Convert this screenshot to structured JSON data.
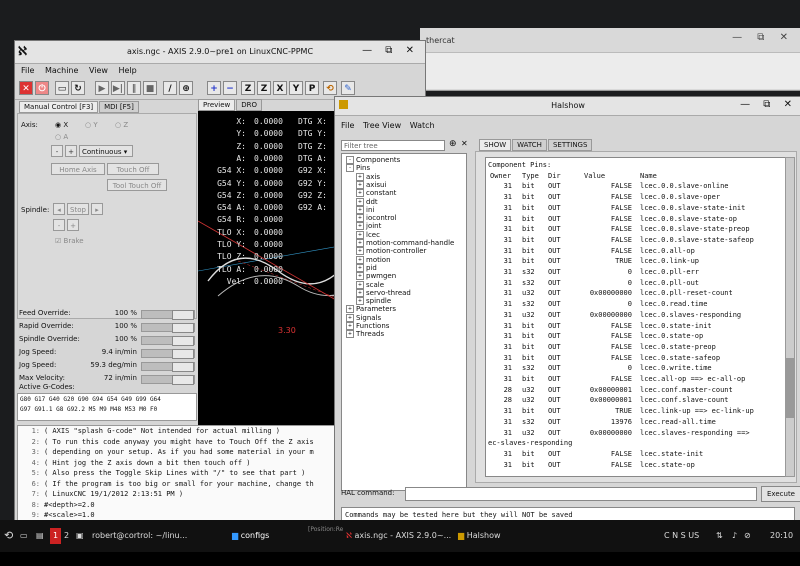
{
  "bg_window": {
    "tab_text": "thercat"
  },
  "axis": {
    "title": "axis.ngc - AXIS 2.9.0~pre1 on LinuxCNC-PPMC",
    "menu": [
      "File",
      "Machine",
      "View",
      "Help"
    ],
    "tabs": [
      "Manual Control [F3]",
      "MDI [F5]"
    ],
    "view_tabs": [
      "Preview",
      "DRO"
    ],
    "axis_label": "Axis:",
    "axes": [
      "X",
      "Y",
      "Z",
      "A"
    ],
    "jog_minus": "-",
    "jog_plus": "+",
    "jog_mode": "Continuous",
    "home_axis": "Home Axis",
    "touch_off": "Touch Off",
    "tool_touch_off": "Tool Touch Off",
    "spindle_label": "Spindle:",
    "stop": "Stop",
    "brake": "Brake",
    "overrides": [
      {
        "label": "Feed Override:",
        "value": "100 %"
      },
      {
        "label": "Rapid Override:",
        "value": "100 %"
      },
      {
        "label": "Spindle Override:",
        "value": "100 %"
      },
      {
        "label": "Jog Speed:",
        "value": "9.4 in/min"
      },
      {
        "label": "Jog Speed:",
        "value": "59.3 deg/min"
      },
      {
        "label": "Max Velocity:",
        "value": "72 in/min"
      }
    ],
    "active_gcodes_label": "Active G-Codes:",
    "active_gcodes": [
      "G80 G17 G40 G20 G90 G94 G54 G49 G99 G64",
      "G97 G91.1 G8 G92.2 M5 M9 M48 M53 M0 F0"
    ],
    "dro": [
      {
        "l": "X:",
        "v": "0.0000",
        "d": "DTG X:"
      },
      {
        "l": "Y:",
        "v": "0.0000",
        "d": "DTG Y:"
      },
      {
        "l": "Z:",
        "v": "0.0000",
        "d": "DTG Z:"
      },
      {
        "l": "A:",
        "v": "0.0000",
        "d": "DTG A:"
      },
      {
        "l": "G54 X:",
        "v": "0.0000",
        "d": "G92 X:"
      },
      {
        "l": "G54 Y:",
        "v": "0.0000",
        "d": "G92 Y:"
      },
      {
        "l": "G54 Z:",
        "v": "0.0000",
        "d": "G92 Z:"
      },
      {
        "l": "G54 A:",
        "v": "0.0000",
        "d": "G92 A:"
      },
      {
        "l": "G54 R:",
        "v": "0.0000",
        "d": ""
      },
      {
        "l": "TLO X:",
        "v": "0.0000",
        "d": ""
      },
      {
        "l": "TLO Y:",
        "v": "0.0000",
        "d": ""
      },
      {
        "l": "TLO Z:",
        "v": "0.0000",
        "d": ""
      },
      {
        "l": "TLO A:",
        "v": "0.0000",
        "d": ""
      },
      {
        "l": "Vel:",
        "v": "0.0000",
        "d": ""
      }
    ],
    "preview_text": "3.30",
    "code_lines": [
      {
        "n": "1:",
        "t": "( AXIS \"splash G-code\" Not intended for actual milling )"
      },
      {
        "n": "2:",
        "t": "( To run this code anyway you might have to Touch Off the Z axis"
      },
      {
        "n": "3:",
        "t": "( depending on your setup. As if you had some material in your m"
      },
      {
        "n": "4:",
        "t": "( Hint jog the Z axis down a bit then touch off )"
      },
      {
        "n": "5:",
        "t": "( Also press the Toggle Skip Lines with \"/\" to see that part )"
      },
      {
        "n": "6:",
        "t": "( If the program is too big or small for your machine, change th"
      },
      {
        "n": "7:",
        "t": "( LinuxCNC 19/1/2012 2:13:51 PM )"
      },
      {
        "n": "8:",
        "t": "#<depth>=2.0"
      },
      {
        "n": "9:",
        "t": "#<scale>=1.0"
      }
    ]
  },
  "halshow": {
    "title": "Halshow",
    "menu": [
      "File",
      "Tree View",
      "Watch"
    ],
    "filter_placeholder": "Filter tree",
    "tabs": [
      "SHOW",
      "WATCH",
      "SETTINGS"
    ],
    "tree": [
      {
        "label": "Components",
        "d": 0,
        "pm": "-"
      },
      {
        "label": "Pins",
        "d": 0,
        "pm": "-"
      },
      {
        "label": "axis",
        "d": 1,
        "pm": "+"
      },
      {
        "label": "axisui",
        "d": 1,
        "pm": "+"
      },
      {
        "label": "constant",
        "d": 1,
        "pm": "+"
      },
      {
        "label": "ddt",
        "d": 1,
        "pm": "+"
      },
      {
        "label": "ini",
        "d": 1,
        "pm": "+"
      },
      {
        "label": "iocontrol",
        "d": 1,
        "pm": "+"
      },
      {
        "label": "joint",
        "d": 1,
        "pm": "+"
      },
      {
        "label": "lcec",
        "d": 1,
        "pm": "+"
      },
      {
        "label": "motion-command-handle",
        "d": 1,
        "pm": "+"
      },
      {
        "label": "motion-controller",
        "d": 1,
        "pm": "+"
      },
      {
        "label": "motion",
        "d": 1,
        "pm": "+"
      },
      {
        "label": "pid",
        "d": 1,
        "pm": "+"
      },
      {
        "label": "pwmgen",
        "d": 1,
        "pm": "+"
      },
      {
        "label": "scale",
        "d": 1,
        "pm": "+"
      },
      {
        "label": "servo-thread",
        "d": 1,
        "pm": "+"
      },
      {
        "label": "spindle",
        "d": 1,
        "pm": "+"
      },
      {
        "label": "Parameters",
        "d": 0,
        "pm": "+"
      },
      {
        "label": "Signals",
        "d": 0,
        "pm": "+"
      },
      {
        "label": "Functions",
        "d": 0,
        "pm": "+"
      },
      {
        "label": "Threads",
        "d": 0,
        "pm": "+"
      }
    ],
    "pins_heading": "Component Pins:",
    "pins_header": {
      "o": "Owner",
      "t": "Type",
      "d": "Dir",
      "v": "Value",
      "n": "Name"
    },
    "pins": [
      {
        "o": "31",
        "t": "bit",
        "d": "OUT",
        "v": "FALSE",
        "n": "lcec.0.0.slave-online"
      },
      {
        "o": "31",
        "t": "bit",
        "d": "OUT",
        "v": "FALSE",
        "n": "lcec.0.0.slave-oper"
      },
      {
        "o": "31",
        "t": "bit",
        "d": "OUT",
        "v": "FALSE",
        "n": "lcec.0.0.slave-state-init"
      },
      {
        "o": "31",
        "t": "bit",
        "d": "OUT",
        "v": "FALSE",
        "n": "lcec.0.0.slave-state-op"
      },
      {
        "o": "31",
        "t": "bit",
        "d": "OUT",
        "v": "FALSE",
        "n": "lcec.0.0.slave-state-preop"
      },
      {
        "o": "31",
        "t": "bit",
        "d": "OUT",
        "v": "FALSE",
        "n": "lcec.0.0.slave-state-safeop"
      },
      {
        "o": "31",
        "t": "bit",
        "d": "OUT",
        "v": "FALSE",
        "n": "lcec.0.all-op"
      },
      {
        "o": "31",
        "t": "bit",
        "d": "OUT",
        "v": "TRUE",
        "n": "lcec.0.link-up"
      },
      {
        "o": "31",
        "t": "s32",
        "d": "OUT",
        "v": "0",
        "n": "lcec.0.pll-err"
      },
      {
        "o": "31",
        "t": "s32",
        "d": "OUT",
        "v": "0",
        "n": "lcec.0.pll-out"
      },
      {
        "o": "31",
        "t": "u32",
        "d": "OUT",
        "v": "0x00000000",
        "n": "lcec.0.pll-reset-count"
      },
      {
        "o": "31",
        "t": "s32",
        "d": "OUT",
        "v": "0",
        "n": "lcec.0.read.time"
      },
      {
        "o": "31",
        "t": "u32",
        "d": "OUT",
        "v": "0x00000000",
        "n": "lcec.0.slaves-responding"
      },
      {
        "o": "31",
        "t": "bit",
        "d": "OUT",
        "v": "FALSE",
        "n": "lcec.0.state-init"
      },
      {
        "o": "31",
        "t": "bit",
        "d": "OUT",
        "v": "FALSE",
        "n": "lcec.0.state-op"
      },
      {
        "o": "31",
        "t": "bit",
        "d": "OUT",
        "v": "FALSE",
        "n": "lcec.0.state-preop"
      },
      {
        "o": "31",
        "t": "bit",
        "d": "OUT",
        "v": "FALSE",
        "n": "lcec.0.state-safeop"
      },
      {
        "o": "31",
        "t": "s32",
        "d": "OUT",
        "v": "0",
        "n": "lcec.0.write.time"
      },
      {
        "o": "31",
        "t": "bit",
        "d": "OUT",
        "v": "FALSE",
        "n": "lcec.all-op ==> ec-all-op"
      },
      {
        "o": "28",
        "t": "u32",
        "d": "OUT",
        "v": "0x00000001",
        "n": "lcec.conf.master-count"
      },
      {
        "o": "28",
        "t": "u32",
        "d": "OUT",
        "v": "0x00000001",
        "n": "lcec.conf.slave-count"
      },
      {
        "o": "31",
        "t": "bit",
        "d": "OUT",
        "v": "TRUE",
        "n": "lcec.link-up ==> ec-link-up"
      },
      {
        "o": "31",
        "t": "s32",
        "d": "OUT",
        "v": "13976",
        "n": "lcec.read-all.time"
      },
      {
        "o": "31",
        "t": "u32",
        "d": "OUT",
        "v": "0x00000000",
        "n": "lcec.slaves-responding ==>"
      },
      {
        "o": "",
        "t": "",
        "d": "",
        "v": "",
        "n": "",
        "wrap": "ec-slaves-responding"
      },
      {
        "o": "31",
        "t": "bit",
        "d": "OUT",
        "v": "FALSE",
        "n": "lcec.state-init"
      },
      {
        "o": "31",
        "t": "bit",
        "d": "OUT",
        "v": "FALSE",
        "n": "lcec.state-op"
      }
    ],
    "hal_command_label": "HAL command:",
    "execute": "Execute",
    "status": "Commands may be tested here but they will NOT be saved"
  },
  "taskbar": {
    "workspaces": [
      "1",
      "2"
    ],
    "items": [
      "robert@cortrol: ~/linu...",
      "configs",
      "axis.ngc - AXIS 2.9.0~...",
      "Halshow"
    ],
    "indicators": "C N S  US",
    "clock": "20:10",
    "tooltip": "[Position:Re"
  }
}
